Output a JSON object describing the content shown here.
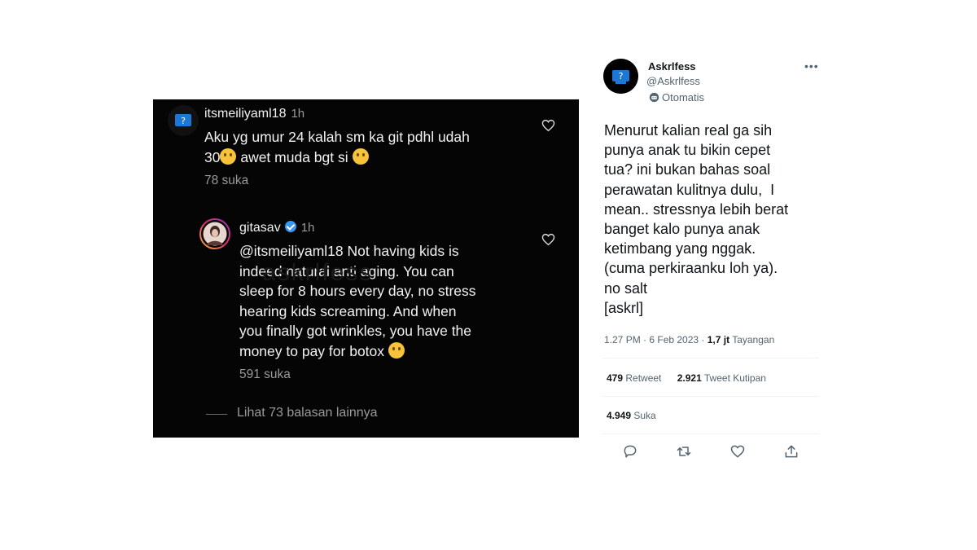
{
  "instagram": {
    "comment": {
      "username": "itsmeiliyaml18",
      "time": "1h",
      "text_line1": "Aku yg umur 24 kalah sm ka git pdhl udah",
      "text_line2_a": "30",
      "text_line2_b": " awet muda bgt si",
      "likes": "78 suka"
    },
    "reply": {
      "username": "gitasav",
      "time": "1h",
      "lines": [
        "@itsmeiliyaml18 Not having kids is",
        "indeed natural anti aging. You can",
        "sleep for 8 hours every day, no stress",
        "hearing kids screaming. And when",
        "you finally got wrinkles, you have the",
        "money to pay for botox"
      ],
      "likes": "591 suka"
    },
    "more_replies": "Lihat 73 balasan lainnya",
    "watermark": "askrlfess"
  },
  "tweet": {
    "name": "Askrlfess",
    "handle": "@Askrlfess",
    "automated_label": "Otomatis",
    "body_lines": [
      "Menurut kalian real ga sih",
      "punya anak tu bikin cepet",
      "tua? ini bukan bahas soal",
      "perawatan kulitnya dulu,  I",
      "mean.. stressnya lebih berat",
      "banget kalo punya anak",
      "ketimbang yang nggak.",
      "(cuma perkiraanku loh ya).",
      "no salt",
      "[askrl]"
    ],
    "timestamp": "1.27 PM · 6 Feb 2023 · ",
    "views_count": "1,7 jt",
    "views_label": " Tayangan",
    "retweets_count": "479",
    "retweets_label": " Retweet",
    "quotes_count": "2.921",
    "quotes_label": " Tweet Kutipan",
    "likes_count": "4.949",
    "likes_label": " Suka"
  },
  "icons": {
    "reply": "reply-icon",
    "retweet": "retweet-icon",
    "like": "heart-icon",
    "share": "share-icon",
    "more": "more-icon",
    "bot": "bot-icon"
  },
  "colors": {
    "twitter_text": "#0f1419",
    "twitter_secondary": "#536471",
    "instagram_bg": "#050505",
    "verified": "#3897f0"
  }
}
